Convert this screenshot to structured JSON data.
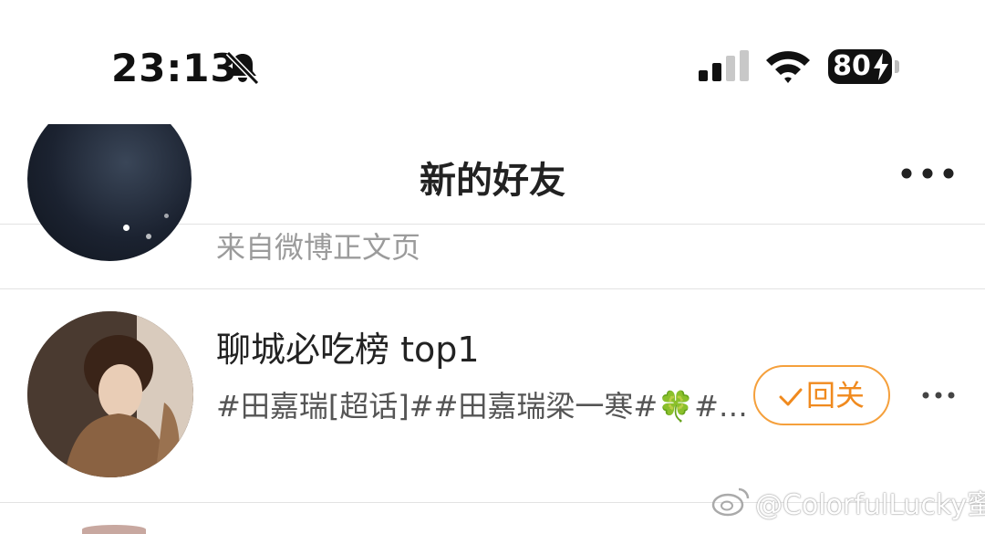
{
  "status_bar": {
    "time": "23:13",
    "battery": "80"
  },
  "nav": {
    "title": "新的好友"
  },
  "rows": [
    {
      "subtitle": "来自微博正文页"
    },
    {
      "name": "聊城必吃榜 top1",
      "description": "#田嘉瑞[超话]##田嘉瑞梁一寒#🍀#…",
      "action_label": "回关",
      "action_icon": "check-icon"
    }
  ],
  "watermark": "@ColorfulLucky蜜",
  "colors": {
    "accent": "#f08a1e",
    "accent_border": "#f5a03c",
    "subtitle": "#9b9b9b"
  }
}
